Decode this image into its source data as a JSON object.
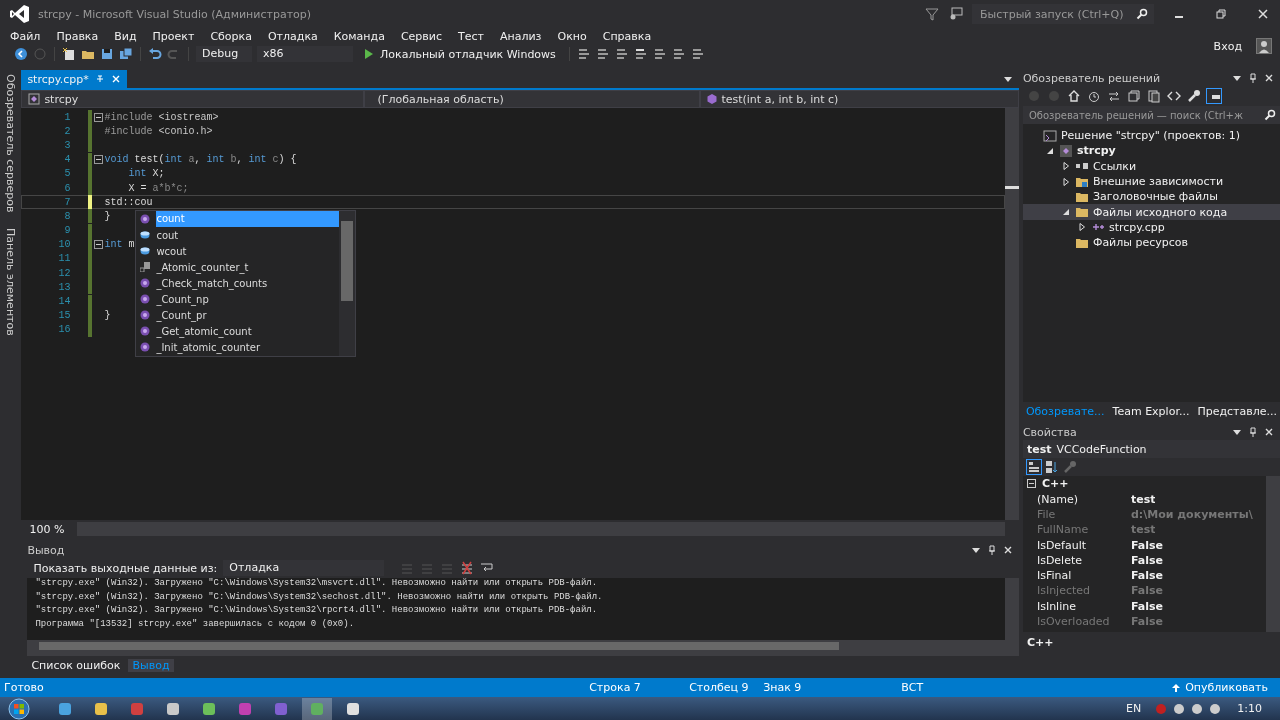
{
  "window": {
    "title": "strcpy - Microsoft Visual Studio (Администратор)",
    "quick_launch": {
      "placeholder": "Быстрый запуск (Ctrl+Q)"
    },
    "sign_in": "Вход"
  },
  "menu": [
    "Файл",
    "Правка",
    "Вид",
    "Проект",
    "Сборка",
    "Отладка",
    "Команда",
    "Сервис",
    "Тест",
    "Анализ",
    "Окно",
    "Справка"
  ],
  "toolbar": {
    "configuration": "Debug",
    "platform": "x86",
    "start": "Локальный отладчик Windows"
  },
  "side_tabs": [
    "Обозреватель серверов",
    "Панель элементов"
  ],
  "editor": {
    "tabs": [
      {
        "label": "strcpy.cpp*",
        "selected": true
      }
    ],
    "nav": [
      "strcpy",
      "(Глобальная область)",
      "test(int a, int b, int c)"
    ],
    "lines": [
      {
        "number": "1",
        "fold": true,
        "current": false,
        "tokens": [
          {
            "kind": "pp",
            "text": "#include"
          },
          {
            "kind": "str",
            "text": " <iostream>"
          }
        ]
      },
      {
        "number": "2",
        "fold": false,
        "current": false,
        "tokens": [
          {
            "kind": "pp",
            "text": "#include"
          },
          {
            "kind": "str",
            "text": " <conio.h>"
          }
        ]
      },
      {
        "number": "3",
        "fold": false,
        "current": false
      },
      {
        "number": "4",
        "fold": true,
        "current": false,
        "tokens": [
          {
            "kind": "kw",
            "text": "void"
          },
          {
            "kind": "plain",
            "text": " test("
          },
          {
            "kind": "kw",
            "text": "int"
          },
          {
            "kind": "param",
            "text": " a"
          },
          {
            "kind": "plain",
            "text": ", "
          },
          {
            "kind": "kw",
            "text": "int"
          },
          {
            "kind": "param",
            "text": " b"
          },
          {
            "kind": "plain",
            "text": ", "
          },
          {
            "kind": "kw",
            "text": "int"
          },
          {
            "kind": "param",
            "text": " c"
          },
          {
            "kind": "plain",
            "text": ") {"
          }
        ]
      },
      {
        "number": "5",
        "fold": false,
        "current": false,
        "tokens": [
          {
            "kind": "kw",
            "text": "    int"
          },
          {
            "kind": "plain",
            "text": " X;"
          }
        ]
      },
      {
        "number": "6",
        "fold": false,
        "current": false,
        "tokens": [
          {
            "kind": "plain",
            "text": "    X = "
          },
          {
            "kind": "param",
            "text": "a*b*c;"
          }
        ]
      },
      {
        "number": "7",
        "fold": false,
        "current": true,
        "tokens": [
          {
            "kind": "plain",
            "text": "std::cou"
          }
        ]
      },
      {
        "number": "8",
        "fold": false,
        "current": false,
        "tokens": [
          {
            "kind": "plain",
            "text": "}"
          }
        ]
      },
      {
        "number": "9",
        "fold": false,
        "current": false
      },
      {
        "number": "10",
        "fold": true,
        "current": false,
        "tokens": [
          {
            "kind": "kw",
            "text": "int"
          },
          {
            "kind": "plain",
            "text": " m"
          }
        ]
      },
      {
        "number": "11",
        "fold": false,
        "current": false
      },
      {
        "number": "12",
        "fold": false,
        "current": false
      },
      {
        "number": "13",
        "fold": false,
        "current": false
      },
      {
        "number": "14",
        "fold": false,
        "current": false
      },
      {
        "number": "15",
        "fold": false,
        "current": false,
        "tokens": [
          {
            "kind": "plain",
            "text": "}"
          }
        ]
      },
      {
        "number": "16",
        "fold": false,
        "current": false
      }
    ],
    "zoom": "100 %"
  },
  "completion": {
    "items": [
      {
        "label": "count",
        "kind": "method",
        "selected": true
      },
      {
        "label": "cout",
        "kind": "variable",
        "selected": false
      },
      {
        "label": "wcout",
        "kind": "variable",
        "selected": false
      },
      {
        "label": "_Atomic_counter_t",
        "kind": "typedef",
        "selected": false
      },
      {
        "label": "_Check_match_counts",
        "kind": "method",
        "selected": false
      },
      {
        "label": "_Count_np",
        "kind": "method",
        "selected": false
      },
      {
        "label": "_Count_pr",
        "kind": "method",
        "selected": false
      },
      {
        "label": "_Get_atomic_count",
        "kind": "method",
        "selected": false
      },
      {
        "label": "_Init_atomic_counter",
        "kind": "method",
        "selected": false
      }
    ]
  },
  "solution": {
    "title": "Обозреватель решений",
    "search": {
      "placeholder": "Обозреватель решений — поиск (Ctrl+ж"
    },
    "tree": [
      {
        "label": "Решение \"strcpy\"  (проектов: 1)",
        "kind": "solution",
        "selected": false,
        "children": [
          {
            "label": "strcpy",
            "kind": "project",
            "expanded": true,
            "selected": false,
            "children": [
              {
                "label": "Ссылки",
                "kind": "references",
                "expanded": false,
                "selected": false
              },
              {
                "label": "Внешние зависимости",
                "kind": "external",
                "expanded": false,
                "selected": false
              },
              {
                "label": "Заголовочные файлы",
                "kind": "folder",
                "selected": false
              },
              {
                "label": "Файлы исходного кода",
                "kind": "folder",
                "expanded": true,
                "selected": true,
                "children": [
                  {
                    "label": "strcpy.cpp",
                    "kind": "file",
                    "expanded": false,
                    "selected": false
                  }
                ]
              },
              {
                "label": "Файлы ресурсов",
                "kind": "folder",
                "selected": false
              }
            ]
          }
        ]
      }
    ],
    "tabs": [
      {
        "label": "Обозревате...",
        "selected": true
      },
      {
        "label": "Team Explor...",
        "selected": false
      },
      {
        "label": "Представле...",
        "selected": false
      }
    ]
  },
  "properties": {
    "title": "Свойства",
    "object_name": "test",
    "object_type": "VCCodeFunction",
    "category": "C++",
    "rows": [
      {
        "name": "(Name)",
        "value": "test",
        "disabled": false
      },
      {
        "name": "File",
        "value": "d:\\Мои документы\\",
        "disabled": true
      },
      {
        "name": "FullName",
        "value": "test",
        "disabled": true
      },
      {
        "name": "IsDefault",
        "value": "False",
        "disabled": false
      },
      {
        "name": "IsDelete",
        "value": "False",
        "disabled": false
      },
      {
        "name": "IsFinal",
        "value": "False",
        "disabled": false
      },
      {
        "name": "IsInjected",
        "value": "False",
        "disabled": true
      },
      {
        "name": "IsInline",
        "value": "False",
        "disabled": false
      },
      {
        "name": "IsOverloaded",
        "value": "False",
        "disabled": true
      }
    ],
    "description": "C++"
  },
  "output": {
    "title": "Вывод",
    "source_label": "Показать выходные данные из:",
    "source": "Отладка",
    "lines": [
      "\"strcpy.exe\" (Win32). Загружено \"C:\\Windows\\System32\\msvcrt.dll\". Невозможно найти или открыть PDB-файл.",
      "\"strcpy.exe\" (Win32). Загружено \"C:\\Windows\\System32\\sechost.dll\". Невозможно найти или открыть PDB-файл.",
      "\"strcpy.exe\" (Win32). Загружено \"C:\\Windows\\System32\\rpcrt4.dll\". Невозможно найти или открыть PDB-файл.",
      "Программа \"[13532] strcpy.exe\" завершилась с кодом 0 (0x0)."
    ],
    "tabs": [
      {
        "label": "Список ошибок",
        "selected": false
      },
      {
        "label": "Вывод",
        "selected": true
      }
    ]
  },
  "status_bar": {
    "message": "Готово",
    "line": "Строка 7",
    "column": "Столбец 9",
    "char": "Знак 9",
    "mode": "ВСТ",
    "publish": "Опубликовать"
  },
  "taskbar": {
    "language": "EN",
    "time": "1:10"
  }
}
